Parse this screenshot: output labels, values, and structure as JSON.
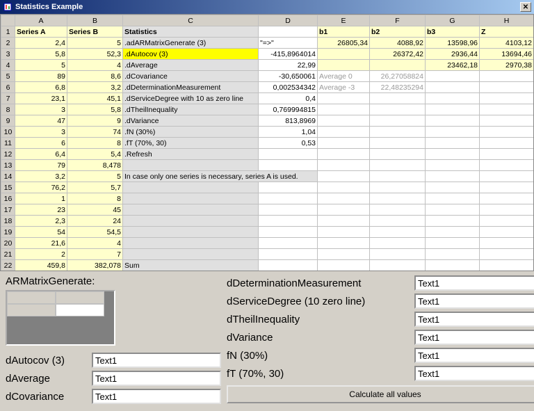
{
  "window": {
    "title": "Statistics Example"
  },
  "columns": [
    "A",
    "B",
    "C",
    "D",
    "E",
    "F",
    "G",
    "H"
  ],
  "header_row": [
    "Series A",
    "Series B",
    "Statistics",
    "",
    "b1",
    "b2",
    "b3",
    "Z"
  ],
  "rows": [
    {
      "n": 2,
      "A": "2,4",
      "B": "5",
      "C": ".adARMatrixGenerate (3)",
      "D": "\"=>\"",
      "E": "26805,34",
      "F": "4088,92",
      "G": "13598,96",
      "H": "4103,12",
      "cD": "lefttxt"
    },
    {
      "n": 3,
      "A": "5,8",
      "B": "52,3",
      "C": ".dAutocov (3)",
      "D": "-415,8964014",
      "E": "",
      "F": "26372,42",
      "G": "2936,44",
      "H": "13694,46",
      "hiC": true
    },
    {
      "n": 4,
      "A": "5",
      "B": "4",
      "C": ".dAverage",
      "D": "22,99",
      "E": "",
      "F": "",
      "G": "23462,18",
      "H": "2970,38"
    },
    {
      "n": 5,
      "A": "89",
      "B": "8,6",
      "C": ".dCovariance",
      "D": "-30,650061",
      "E": "Average 0",
      "F": "26,27058824",
      "G": "",
      "H": "",
      "greyEF": true
    },
    {
      "n": 6,
      "A": "6,8",
      "B": "3,2",
      "C": ".dDeterminationMeasurement",
      "D": "0,002534342",
      "E": "Average -3",
      "F": "22,48235294",
      "G": "",
      "H": "",
      "greyEF": true
    },
    {
      "n": 7,
      "A": "23,1",
      "B": "45,1",
      "C": ".dServiceDegree with 10 as zero line",
      "D": "0,4",
      "E": "",
      "F": "",
      "G": "",
      "H": ""
    },
    {
      "n": 8,
      "A": "3",
      "B": "5,8",
      "C": ".dTheilInequality",
      "D": "0,769994815",
      "E": "",
      "F": "",
      "G": "",
      "H": ""
    },
    {
      "n": 9,
      "A": "47",
      "B": "9",
      "C": ".dVariance",
      "D": "813,8969",
      "E": "",
      "F": "",
      "G": "",
      "H": ""
    },
    {
      "n": 10,
      "A": "3",
      "B": "74",
      "C": ".fN (30%)",
      "D": "1,04",
      "E": "",
      "F": "",
      "G": "",
      "H": ""
    },
    {
      "n": 11,
      "A": "6",
      "B": "8",
      "C": ".fT (70%, 30)",
      "D": "0,53",
      "E": "",
      "F": "",
      "G": "",
      "H": ""
    },
    {
      "n": 12,
      "A": "6,4",
      "B": "5,4",
      "C": ".Refresh",
      "D": "",
      "E": "",
      "F": "",
      "G": "",
      "H": ""
    },
    {
      "n": 13,
      "A": "79",
      "B": "8,478",
      "C": "",
      "D": "",
      "E": "",
      "F": "",
      "G": "",
      "H": ""
    },
    {
      "n": 14,
      "A": "3,2",
      "B": "5",
      "C": "In case only one series is necessary, series A is used.",
      "D": "",
      "E": "",
      "F": "",
      "G": "",
      "H": "",
      "span": true
    },
    {
      "n": 15,
      "A": "76,2",
      "B": "5,7",
      "C": "",
      "D": "",
      "E": "",
      "F": "",
      "G": "",
      "H": ""
    },
    {
      "n": 16,
      "A": "1",
      "B": "8",
      "C": "",
      "D": "",
      "E": "",
      "F": "",
      "G": "",
      "H": ""
    },
    {
      "n": 17,
      "A": "23",
      "B": "45",
      "C": "",
      "D": "",
      "E": "",
      "F": "",
      "G": "",
      "H": ""
    },
    {
      "n": 18,
      "A": "2,3",
      "B": "24",
      "C": "",
      "D": "",
      "E": "",
      "F": "",
      "G": "",
      "H": ""
    },
    {
      "n": 19,
      "A": "54",
      "B": "54,5",
      "C": "",
      "D": "",
      "E": "",
      "F": "",
      "G": "",
      "H": ""
    },
    {
      "n": 20,
      "A": "21,6",
      "B": "4",
      "C": "",
      "D": "",
      "E": "",
      "F": "",
      "G": "",
      "H": ""
    },
    {
      "n": 21,
      "A": "2",
      "B": "7",
      "C": "",
      "D": "",
      "E": "",
      "F": "",
      "G": "",
      "H": ""
    },
    {
      "n": 22,
      "A": "459,8",
      "B": "382,078",
      "C": "Sum",
      "D": "",
      "E": "",
      "F": "",
      "G": "",
      "H": ""
    }
  ],
  "panel": {
    "armatrix_label": "ARMatrixGenerate:",
    "left_fields": [
      {
        "label": "dAutocov (3)",
        "value": "Text1"
      },
      {
        "label": "dAverage",
        "value": "Text1"
      },
      {
        "label": "dCovariance",
        "value": "Text1"
      }
    ],
    "right_fields": [
      {
        "label": "dDeterminationMeasurement",
        "value": "Text1"
      },
      {
        "label": "dServiceDegree (10 zero line)",
        "value": "Text1"
      },
      {
        "label": "dTheilInequality",
        "value": "Text1"
      },
      {
        "label": "dVariance",
        "value": "Text1"
      },
      {
        "label": "fN (30%)",
        "value": "Text1"
      },
      {
        "label": "fT (70%, 30)",
        "value": "Text1"
      }
    ],
    "calc_button": "Calculate all values"
  }
}
